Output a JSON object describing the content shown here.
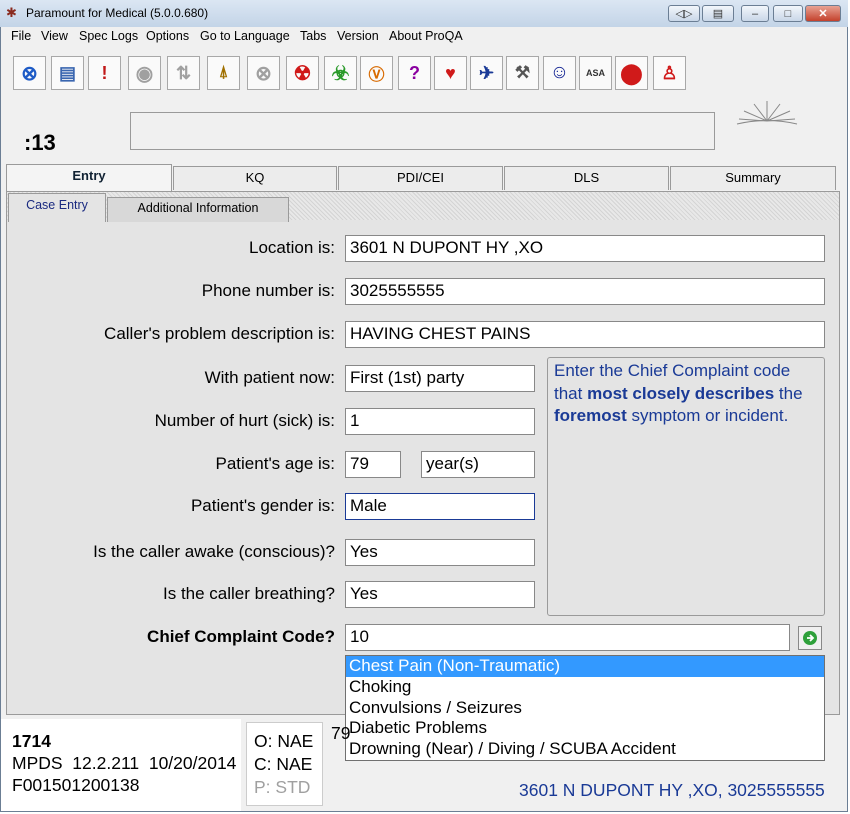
{
  "window": {
    "title": "Paramount for Medical (5.0.0.680)"
  },
  "menu": [
    "File",
    "View",
    "Spec Logs",
    "Options",
    "Go to Language",
    "Tabs",
    "Version",
    "About ProQA"
  ],
  "timer": ":13",
  "tabs": [
    "Entry",
    "KQ",
    "PDI/CEI",
    "DLS",
    "Summary"
  ],
  "subtabs": [
    "Case Entry",
    "Additional Information"
  ],
  "toolbar_icons": [
    "cancel-icon",
    "document-icon",
    "document-alert-icon",
    "target-icon",
    "sort-arrows-icon",
    "person-pin-icon",
    "close-circle-icon",
    "radiation-icon",
    "biohazard-icon",
    "v-badge-icon",
    "question-icon",
    "heart-icon",
    "aircraft-icon",
    "tools-icon",
    "smiley-icon",
    "asa-icon",
    "stop-icon",
    "person-icon"
  ],
  "form": {
    "location_label": "Location is:",
    "location_value": "3601 N DUPONT HY ,XO",
    "phone_label": "Phone number is:",
    "phone_value": "3025555555",
    "problem_label": "Caller's problem description is:",
    "problem_value": "HAVING CHEST PAINS",
    "with_patient_label": "With patient now:",
    "with_patient_value": "First (1st) party",
    "hurt_label": "Number of hurt (sick) is:",
    "hurt_value": "1",
    "age_label": "Patient's age is:",
    "age_value": "79",
    "age_unit": "year(s)",
    "gender_label": "Patient's gender is:",
    "gender_value": "Male",
    "awake_label": "Is the caller awake (conscious)?",
    "awake_value": "Yes",
    "breathing_label": "Is the caller breathing?",
    "breathing_value": "Yes",
    "cc_label": "Chief Complaint Code?",
    "cc_value": "10"
  },
  "info": {
    "p1": "Enter the Chief Complaint code that ",
    "b1": "most closely describes",
    "p2": " the ",
    "b2": "foremost",
    "p3": " symptom or incident."
  },
  "dropdown": [
    "Chest Pain (Non-Traumatic)",
    "Choking",
    "Convulsions / Seizures",
    "Diabetic Problems",
    "Drowning (Near) / Diving / SCUBA Accident"
  ],
  "status": {
    "case_id": "1714",
    "mpds": "MPDS  12.2.211  10/20/2014",
    "file": "F001501200138",
    "o": "O: NAE",
    "c": "C: NAE",
    "p": "P: STD",
    "peek": "79",
    "address": "3601 N DUPONT HY ,XO, 3025555555"
  },
  "colors": {
    "accent": "#1a3a96",
    "selection": "#3399ff"
  }
}
